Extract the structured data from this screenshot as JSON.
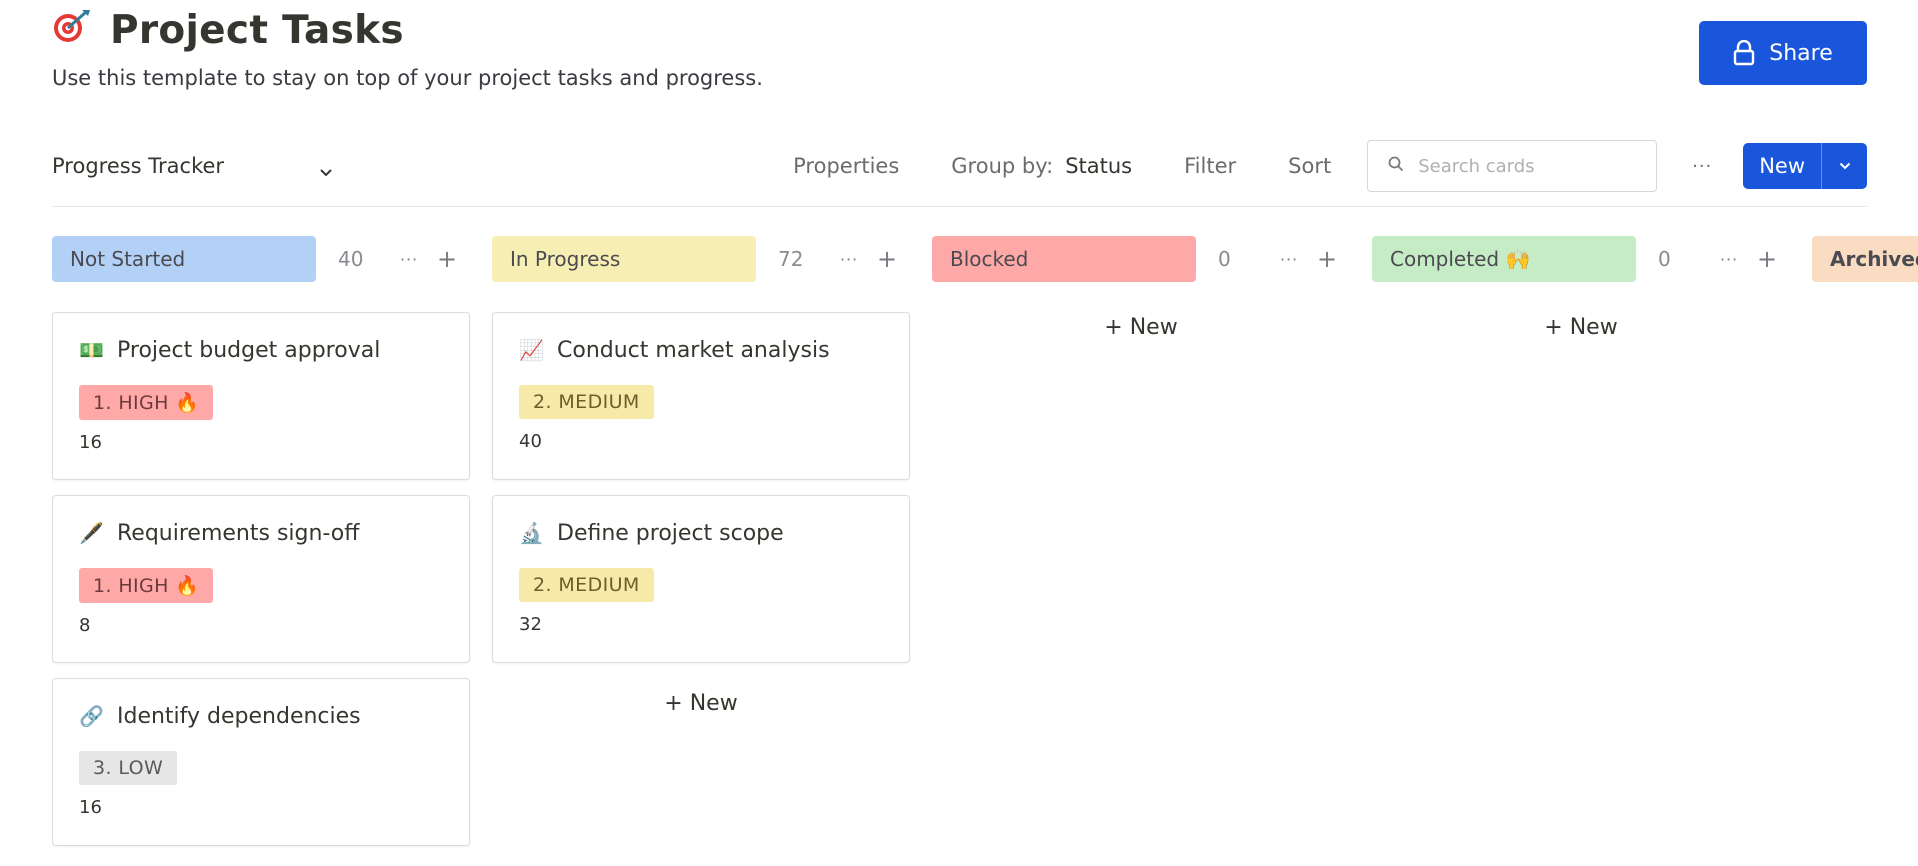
{
  "page": {
    "title": "Project Tasks",
    "title_icon": "target-icon",
    "subtitle": "Use this template to stay on top of your project tasks and progress.",
    "share_label": "Share"
  },
  "toolbar": {
    "view_name": "Progress Tracker",
    "properties_label": "Properties",
    "group_by_label": "Group by:",
    "group_by_value": "Status",
    "filter_label": "Filter",
    "sort_label": "Sort",
    "search_placeholder": "Search cards",
    "more_label": "···",
    "new_label": "New"
  },
  "colors": {
    "accent": "#1a56db",
    "not_started": "#b3d1f7",
    "in_progress": "#f7eeb3",
    "blocked": "#ffa8a8",
    "completed": "#c6ecc6",
    "archived": "#f9dcc2"
  },
  "columns": [
    {
      "label": "Not Started",
      "count": "40",
      "cards": [
        {
          "emoji": "💵",
          "title": "Project budget approval",
          "tag": "1. HIGH 🔥",
          "number": "16"
        },
        {
          "emoji": "🖋️",
          "title": "Requirements sign-off",
          "tag": "1. HIGH 🔥",
          "number": "8"
        },
        {
          "emoji": "🔗",
          "title": "Identify dependencies",
          "tag": "3. LOW",
          "number": "16"
        }
      ]
    },
    {
      "label": "In Progress",
      "count": "72",
      "cards": [
        {
          "emoji": "📈",
          "title": "Conduct market analysis",
          "tag": "2. MEDIUM",
          "number": "40"
        },
        {
          "emoji": "🔬",
          "title": "Define project scope",
          "tag": "2. MEDIUM",
          "number": "32"
        }
      ],
      "add_new": "+ New"
    },
    {
      "label": "Blocked",
      "count": "0",
      "add_new": "+ New"
    },
    {
      "label": "Completed 🙌",
      "count": "0",
      "add_new": "+ New"
    },
    {
      "label": "Archived"
    }
  ]
}
